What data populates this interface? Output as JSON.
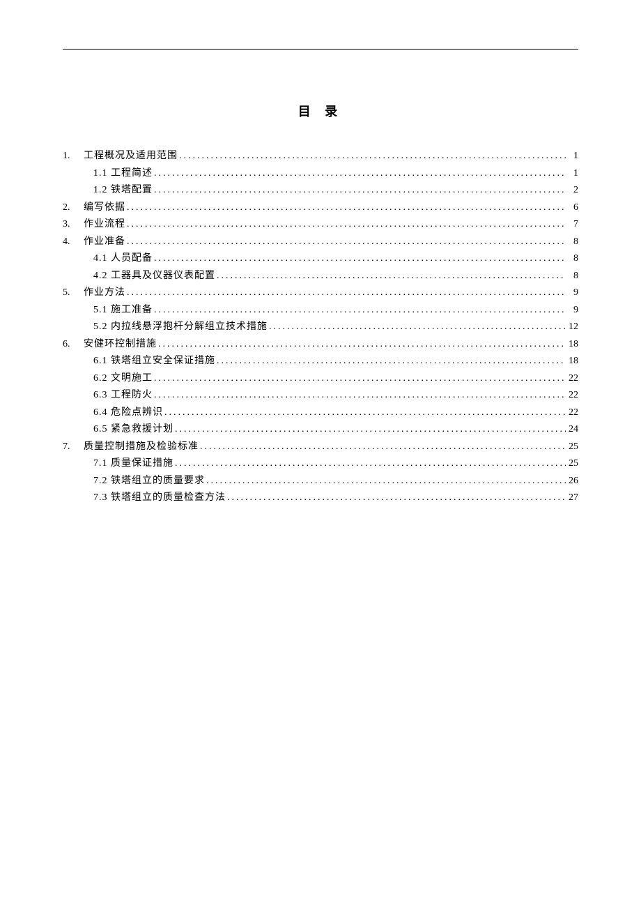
{
  "title": "目 录",
  "toc": [
    {
      "level": 1,
      "num": "1.",
      "label": "工程概况及适用范围",
      "page": "1"
    },
    {
      "level": 2,
      "num": "",
      "label": "1.1 工程简述",
      "page": "1"
    },
    {
      "level": 2,
      "num": "",
      "label": "1.2 铁塔配置",
      "page": "2"
    },
    {
      "level": 1,
      "num": "2.",
      "label": "编写依据",
      "page": "6"
    },
    {
      "level": 1,
      "num": "3.",
      "label": "作业流程",
      "page": "7"
    },
    {
      "level": 1,
      "num": "4.",
      "label": "作业准备",
      "page": "8"
    },
    {
      "level": 2,
      "num": "",
      "label": "4.1 人员配备",
      "page": "8"
    },
    {
      "level": 2,
      "num": "",
      "label": "4.2 工器具及仪器仪表配置",
      "page": "8"
    },
    {
      "level": 1,
      "num": "5.",
      "label": "作业方法",
      "page": "9"
    },
    {
      "level": 2,
      "num": "",
      "label": "5.1 施工准备",
      "page": "9"
    },
    {
      "level": 2,
      "num": "",
      "label": "5.2 内拉线悬浮抱杆分解组立技术措施",
      "page": "12"
    },
    {
      "level": 1,
      "num": "6.",
      "label": "安健环控制措施",
      "page": "18"
    },
    {
      "level": 2,
      "num": "",
      "label": "6.1 铁塔组立安全保证措施",
      "page": "18"
    },
    {
      "level": 2,
      "num": "",
      "label": "6.2 文明施工",
      "page": "22"
    },
    {
      "level": 2,
      "num": "",
      "label": "6.3 工程防火",
      "page": "22"
    },
    {
      "level": 2,
      "num": "",
      "label": "6.4 危险点辨识",
      "page": "22"
    },
    {
      "level": 2,
      "num": "",
      "label": "6.5 紧急救援计划",
      "page": "24"
    },
    {
      "level": 1,
      "num": "7.",
      "label": "质量控制措施及检验标准",
      "page": "25"
    },
    {
      "level": 2,
      "num": "",
      "label": "7.1 质量保证措施",
      "page": "25"
    },
    {
      "level": 2,
      "num": "",
      "label": "7.2 铁塔组立的质量要求",
      "page": "26"
    },
    {
      "level": 2,
      "num": "",
      "label": "7.3 铁塔组立的质量检查方法",
      "page": "27"
    }
  ]
}
